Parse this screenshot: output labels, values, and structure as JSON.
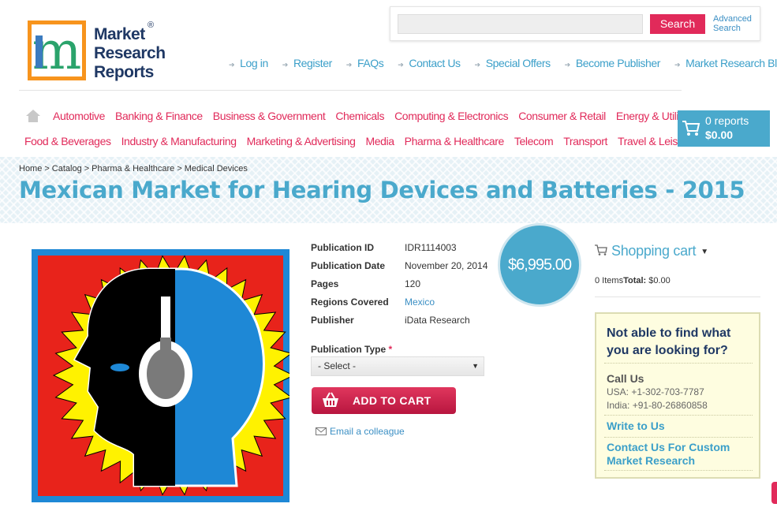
{
  "brand": {
    "logo_mark": "m",
    "name_lines": [
      "Market",
      "Research",
      "Reports"
    ],
    "registered": "®"
  },
  "search": {
    "placeholder": "",
    "button_label": "Search",
    "advanced_label": "Advanced Search"
  },
  "top_links": [
    "Log in",
    "Register",
    "FAQs",
    "Contact Us",
    "Special Offers",
    "Become Publisher",
    "Market Research Blog"
  ],
  "categories_row1": [
    "Automotive",
    "Banking & Finance",
    "Business & Government",
    "Chemicals",
    "Computing & Electronics",
    "Consumer & Retail",
    "Energy & Utilities"
  ],
  "categories_row2": [
    "Food & Beverages",
    "Industry & Manufacturing",
    "Marketing & Advertising",
    "Media",
    "Pharma & Healthcare",
    "Telecom",
    "Transport",
    "Travel & Leisure"
  ],
  "cart_button": {
    "reports": "0 reports",
    "amount": "$0.00"
  },
  "breadcrumb": [
    "Home",
    "Catalog",
    "Pharma & Healthcare",
    "Medical Devices"
  ],
  "breadcrumb_separator": ">",
  "page_title": "Mexican Market for Hearing Devices and Batteries - 2015",
  "product": {
    "meta": [
      {
        "key": "Publication ID",
        "value": "IDR1114003",
        "link": false
      },
      {
        "key": "Publication Date",
        "value": "November 20, 2014",
        "link": false
      },
      {
        "key": "Pages",
        "value": "120",
        "link": false
      },
      {
        "key": "Regions Covered",
        "value": "Mexico",
        "link": true
      },
      {
        "key": "Publisher",
        "value": "iData Research",
        "link": false
      }
    ],
    "price": "$6,995.00",
    "publication_type_label": "Publication Type",
    "required_mark": "*",
    "publication_type_selected": "- Select -",
    "add_to_cart_label": "ADD TO CART",
    "email_colleague_label": "Email a colleague"
  },
  "sidebar": {
    "cart_title": "Shopping cart",
    "items_text": "0 Items",
    "total_label": "Total:",
    "total_value": "$0.00",
    "help": {
      "question": "Not able to find what you are looking for?",
      "call_title": "Call Us",
      "phone_usa": "USA: +1-302-703-7787",
      "phone_india": "India: +91-80-26860858",
      "write_label": "Write to Us",
      "custom_label": "Contact Us For Custom Market Research"
    }
  },
  "colors": {
    "accent_pink": "#e12a5a",
    "accent_blue": "#4aa9cc",
    "brand_navy": "#1f3864",
    "logo_orange": "#f7941d"
  },
  "icons": [
    "home-icon",
    "cart-icon",
    "basket-icon",
    "email-icon",
    "chevron-down-icon",
    "arrow-bullet-icon"
  ]
}
